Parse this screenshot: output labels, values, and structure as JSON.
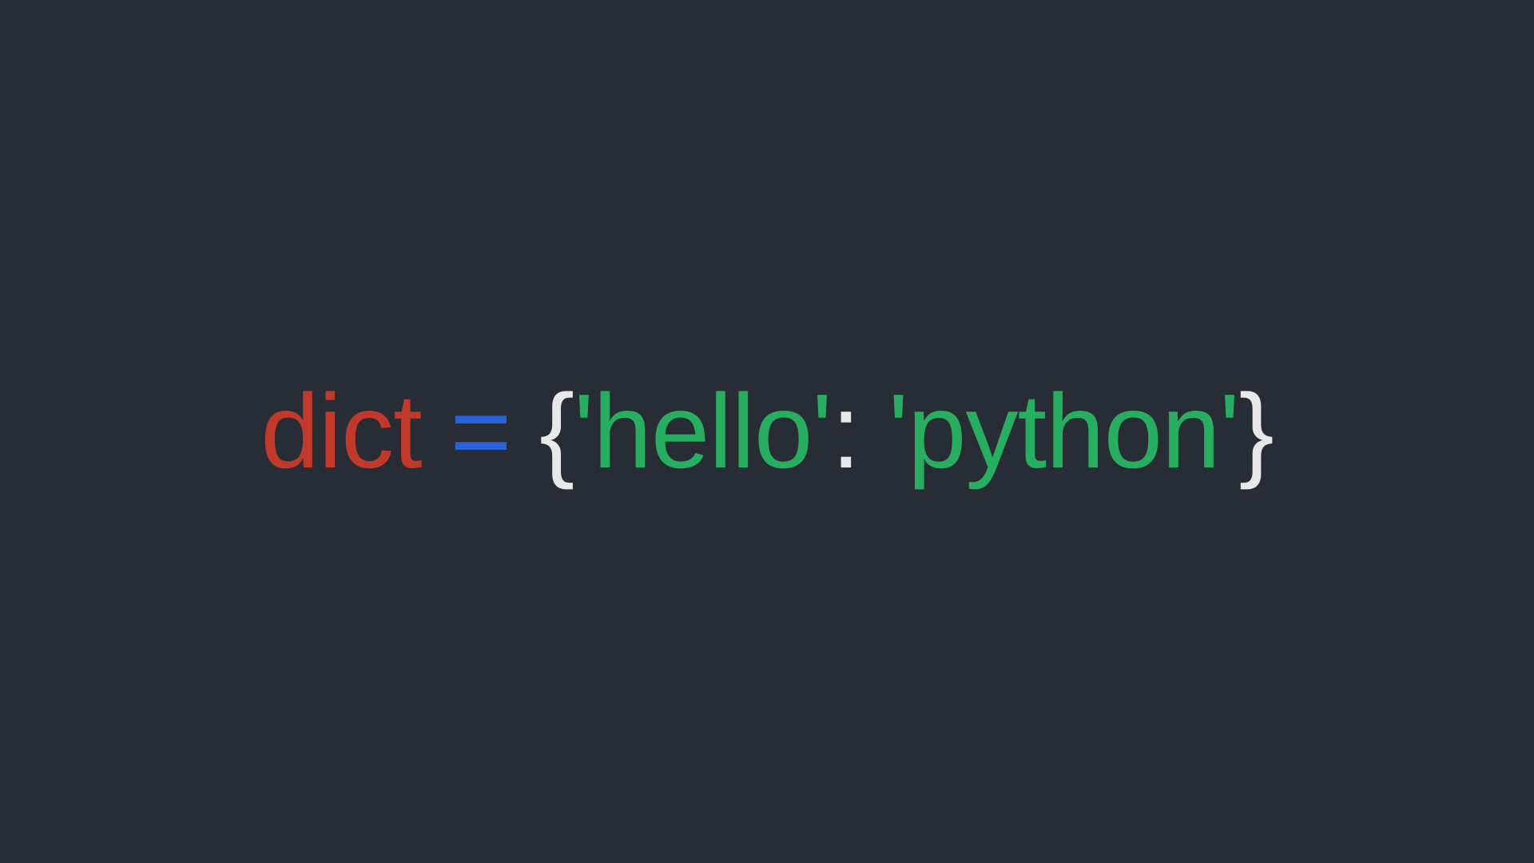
{
  "code": {
    "variable": "dict",
    "operator": "=",
    "brace_open": "{",
    "string_key": "'hello'",
    "colon": ":",
    "string_value": "'python'",
    "brace_close": "}"
  },
  "colors": {
    "background": "#282c34",
    "keyword": "#c0392b",
    "operator": "#2962d9",
    "brace": "#e8e8e8",
    "string": "#27ae60"
  }
}
